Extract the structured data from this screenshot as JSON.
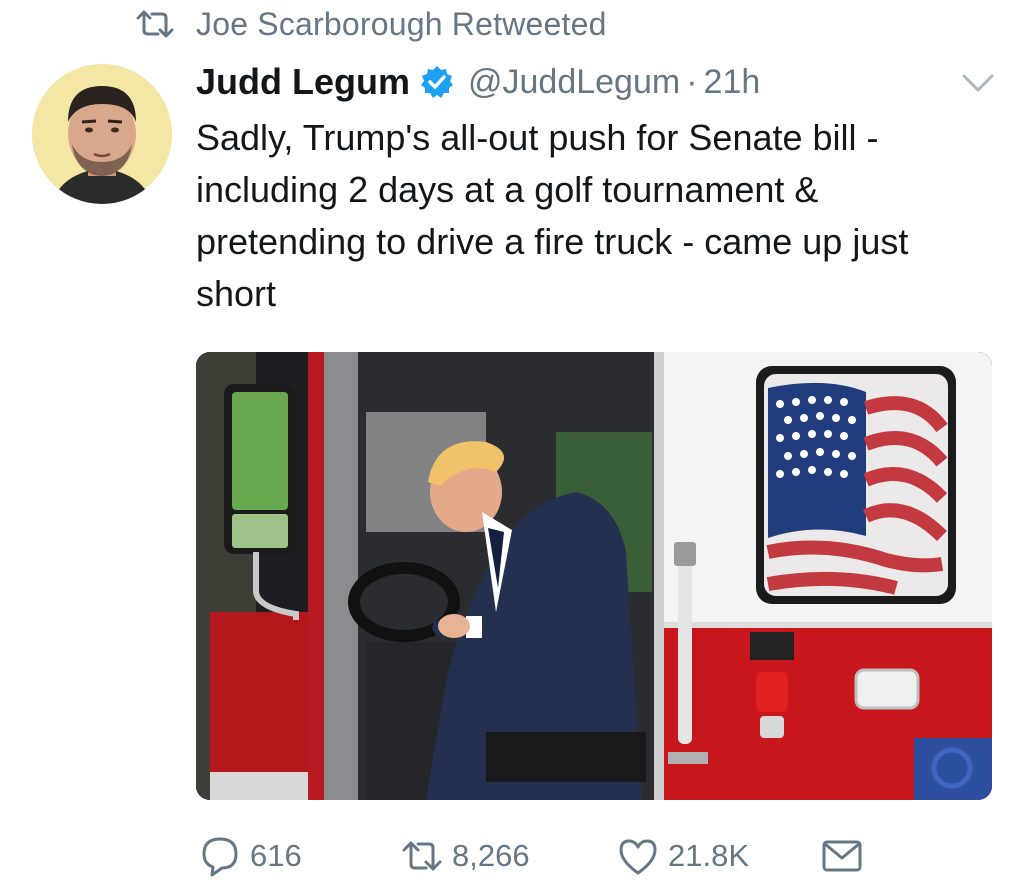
{
  "social_context": {
    "text": "Joe Scarborough Retweeted",
    "icon": "retweet-icon"
  },
  "tweet": {
    "author_name": "Judd Legum",
    "verified": true,
    "handle": "@JuddLegum",
    "separator": "·",
    "time": "21h",
    "text": "Sadly, Trump's all-out push for Senate bill - including 2 days at a golf tournament & pretending to drive a fire truck - came up just short"
  },
  "actions": {
    "reply_count": "616",
    "retweet_count": "8,266",
    "like_count": "21.8K"
  },
  "colors": {
    "secondary_text": "#657786",
    "primary_text": "#14171a",
    "verified_blue": "#1da1f2",
    "truck_red": "#c8161d"
  }
}
